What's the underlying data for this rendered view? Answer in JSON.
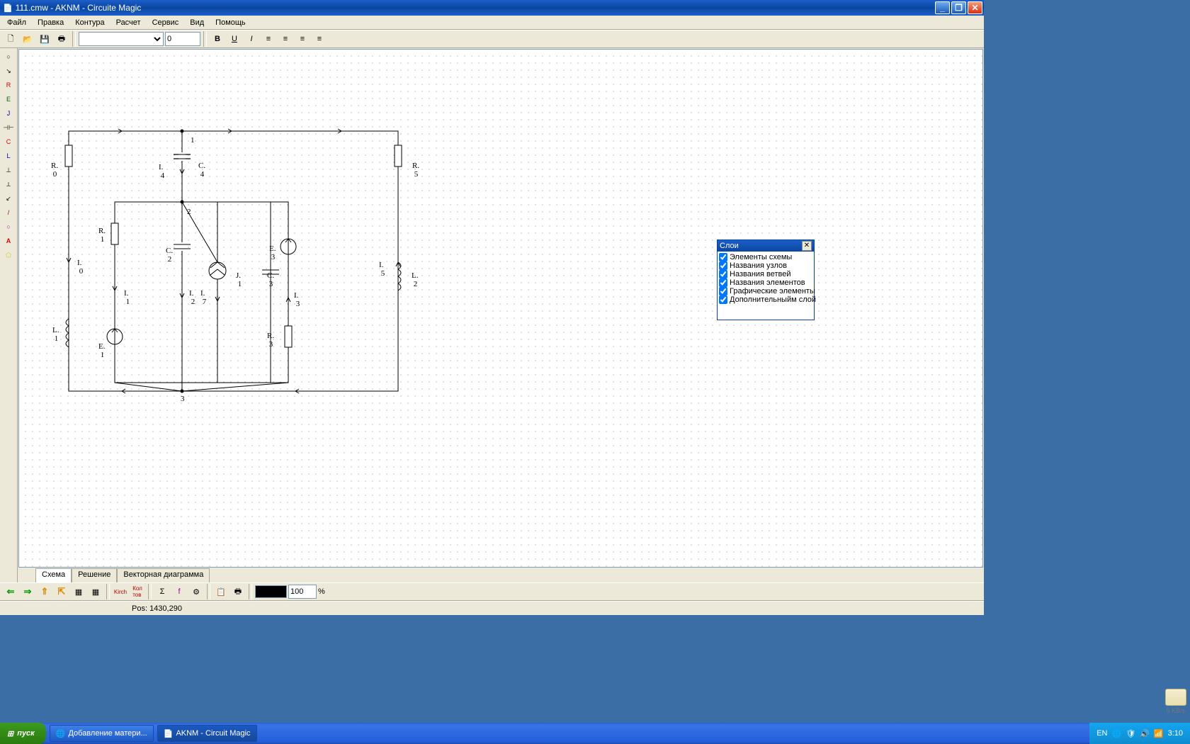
{
  "title": "111.cmw - AKNM - Circuite Magic",
  "menu": [
    "Файл",
    "Правка",
    "Контура",
    "Расчет",
    "Сервис",
    "Вид",
    "Помощь"
  ],
  "toolbar": {
    "size_value": "0"
  },
  "left_tools": [
    "○",
    "↘",
    "R",
    "E",
    "J",
    "⊣⊢",
    "C",
    "L",
    "⊥",
    "⟂",
    "↙",
    "/",
    "○",
    "A",
    "⬠"
  ],
  "tabs": [
    "Схема",
    "Решение",
    "Векторная диаграмма"
  ],
  "active_tab": 0,
  "bottom": {
    "zoom": "100",
    "zoom_suffix": "%"
  },
  "status": {
    "pos": "Pos: 1430,290"
  },
  "layers": {
    "title": "Слои",
    "items": [
      "Элементы схемы",
      "Названия узлов",
      "Названия ветвей",
      "Названия элементов",
      "Графические элементы",
      "Дополнительныйм слой"
    ]
  },
  "circuit": {
    "nodes": {
      "n1": "1",
      "n2": "2",
      "n3": "3"
    },
    "labels": {
      "R0": "R.\n 0",
      "R5": "R.\n 5",
      "R1": "R.\n 1",
      "R3": "R.\n 3",
      "C4": "C.\n 4",
      "C2": "C.\n 2",
      "C3": "C.\n 3",
      "L1": "L.\n 1",
      "L2": "L.\n 2",
      "E1": "E.\n 1",
      "E3": "E.\n 3",
      "J1": "J.\n 1",
      "I0": "I.\n 0",
      "I1": "I.\n 1",
      "I2": "I.\n 2",
      "I3": "I.\n 3",
      "I4": "I.\n 4",
      "I5": "I.\n 5",
      "I7": "I.\n 7"
    }
  },
  "taskbar": {
    "start": "пуск",
    "tasks": [
      "Добавление матери...",
      "AKNM - Circuit Magic"
    ],
    "lang": "EN",
    "clock": "3:10",
    "net": "5 KB/s"
  }
}
